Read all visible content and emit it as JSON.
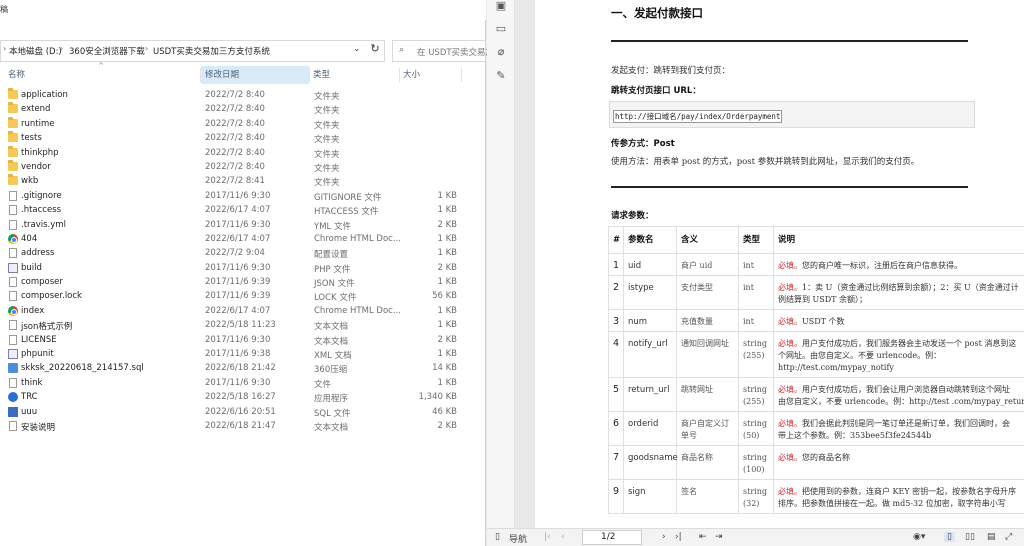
{
  "explorer": {
    "title_fragment": "稿",
    "breadcrumb": [
      "本地磁盘 (D:)",
      "360安全浏览器下载",
      "USDT买卖交易加三方支付系统"
    ],
    "search_placeholder": "在 USDT买卖交易加",
    "columns": {
      "name": "名称",
      "date": "修改日期",
      "type": "类型",
      "size": "大小"
    },
    "files": [
      {
        "name": "application",
        "date": "2022/7/2 8:40",
        "type": "文件夹",
        "size": "",
        "icon": "folder"
      },
      {
        "name": "extend",
        "date": "2022/7/2 8:40",
        "type": "文件夹",
        "size": "",
        "icon": "folder"
      },
      {
        "name": "runtime",
        "date": "2022/7/2 8:40",
        "type": "文件夹",
        "size": "",
        "icon": "folder"
      },
      {
        "name": "tests",
        "date": "2022/7/2 8:40",
        "type": "文件夹",
        "size": "",
        "icon": "folder"
      },
      {
        "name": "thinkphp",
        "date": "2022/7/2 8:40",
        "type": "文件夹",
        "size": "",
        "icon": "folder"
      },
      {
        "name": "vendor",
        "date": "2022/7/2 8:40",
        "type": "文件夹",
        "size": "",
        "icon": "folder"
      },
      {
        "name": "wkb",
        "date": "2022/7/2 8:41",
        "type": "文件夹",
        "size": "",
        "icon": "folder"
      },
      {
        "name": ".gitignore",
        "date": "2017/11/6 9:30",
        "type": "GITIGNORE 文件",
        "size": "1 KB",
        "icon": "doc"
      },
      {
        "name": ".htaccess",
        "date": "2022/6/17 4:07",
        "type": "HTACCESS 文件",
        "size": "1 KB",
        "icon": "doc"
      },
      {
        "name": ".travis.yml",
        "date": "2017/11/6 9:30",
        "type": "YML 文件",
        "size": "2 KB",
        "icon": "doc"
      },
      {
        "name": "404",
        "date": "2022/6/17 4:07",
        "type": "Chrome HTML Doc...",
        "size": "1 KB",
        "icon": "chrome"
      },
      {
        "name": "address",
        "date": "2022/7/2 9:04",
        "type": "配置设置",
        "size": "1 KB",
        "icon": "doc"
      },
      {
        "name": "build",
        "date": "2017/11/6 9:30",
        "type": "PHP 文件",
        "size": "2 KB",
        "icon": "php"
      },
      {
        "name": "composer",
        "date": "2017/11/6 9:39",
        "type": "JSON 文件",
        "size": "1 KB",
        "icon": "doc"
      },
      {
        "name": "composer.lock",
        "date": "2017/11/6 9:39",
        "type": "LOCK 文件",
        "size": "56 KB",
        "icon": "doc"
      },
      {
        "name": "index",
        "date": "2022/6/17 4:07",
        "type": "Chrome HTML Doc...",
        "size": "1 KB",
        "icon": "chrome"
      },
      {
        "name": "json格式示例",
        "date": "2022/5/18 11:23",
        "type": "文本文档",
        "size": "1 KB",
        "icon": "doc"
      },
      {
        "name": "LICENSE",
        "date": "2017/11/6 9:30",
        "type": "文本文档",
        "size": "2 KB",
        "icon": "doc"
      },
      {
        "name": "phpunit",
        "date": "2017/11/6 9:38",
        "type": "XML 文档",
        "size": "1 KB",
        "icon": "php"
      },
      {
        "name": "skksk_20220618_214157.sql",
        "date": "2022/6/18 21:42",
        "type": "360压缩",
        "size": "14 KB",
        "icon": "zip"
      },
      {
        "name": "think",
        "date": "2017/11/6 9:30",
        "type": "文件",
        "size": "1 KB",
        "icon": "doc"
      },
      {
        "name": "TRC",
        "date": "2022/5/18 16:27",
        "type": "应用程序",
        "size": "1,340 KB",
        "icon": "trc"
      },
      {
        "name": "uuu",
        "date": "2022/6/16 20:51",
        "type": "SQL 文件",
        "size": "46 KB",
        "icon": "uuu"
      },
      {
        "name": "安装说明",
        "date": "2022/6/18 21:47",
        "type": "文本文档",
        "size": "2 KB",
        "icon": "doc"
      }
    ]
  },
  "viewer": {
    "heading": "一、发起付款接口",
    "intro": "发起支付：跳转到我们支付页：",
    "url_label": "跳转支付页接口 URL：",
    "url_value": "http://接口域名/pay/index/Orderpayment",
    "method_label": "传参方式：Post",
    "method_desc": "使用方法：用表单 post 的方式，post 参数并跳转到此网址，显示我们的支付页。",
    "params_label": "请求参数：",
    "table_headers": [
      "#",
      "参数名",
      "含义",
      "类型",
      "说明"
    ],
    "params": [
      {
        "no": "1",
        "name": "uid",
        "meaning": "商户 uid",
        "type": "int",
        "req": "必填。",
        "desc": [
          "您的商户唯一标识，注册后在商户信息获得。"
        ]
      },
      {
        "no": "2",
        "name": "istype",
        "meaning": "支付类型",
        "type": "int",
        "req": "必填。",
        "desc": [
          "1：卖 U（资金通过比例结算到余额）；2：买 U（资金通过计",
          "例结算到 USDT 余额）；"
        ]
      },
      {
        "no": "3",
        "name": "num",
        "meaning": "充值数量",
        "type": "int",
        "req": "必填。",
        "desc": [
          "USDT 个数"
        ]
      },
      {
        "no": "4",
        "name": "notify_url",
        "meaning": "通知回调网址",
        "type": "string (255)",
        "req": "必填。",
        "desc": [
          "用户支付成功后，我们服务器会主动发送一个 post 消息到这",
          "个网址。由您自定义。不要 urlencode。例：",
          "http://test.com/mypay_notify"
        ]
      },
      {
        "no": "5",
        "name": "return_url",
        "meaning": "跳转网址",
        "type": "string (255)",
        "req": "必填。",
        "desc": [
          "用户支付成功后，我们会让用户浏览器自动跳转到这个网址",
          "由您自定义，不要 urlencode。例：http://test .com/mypay_return"
        ]
      },
      {
        "no": "6",
        "name": "orderid",
        "meaning": "商户自定义订单号",
        "type": "string (50)",
        "req": "必填。",
        "desc": [
          "我们会据此判别是同一笔订单还是新订单，我们回调时，会",
          "带上这个参数。例：353bee5f3fe24544b"
        ]
      },
      {
        "no": "7",
        "name": "goodsname",
        "meaning": "商品名称",
        "type": "string (100)",
        "req": "必填。",
        "desc": [
          "您的商品名称"
        ]
      },
      {
        "no": "9",
        "name": "sign",
        "meaning": "签名",
        "type": "string (32)",
        "req": "必填。",
        "desc": [
          "把使用到的参数，连商户 KEY 密钥一起，按参数名字母升序",
          "排序。把参数值拼接在一起。做 md5-32 位加密，取字符串小写"
        ]
      }
    ],
    "toolbar": {
      "nav": "导航",
      "page": "1/2"
    },
    "rail_icons": [
      "image-icon",
      "comment-icon",
      "attach-icon",
      "sign-icon"
    ]
  }
}
